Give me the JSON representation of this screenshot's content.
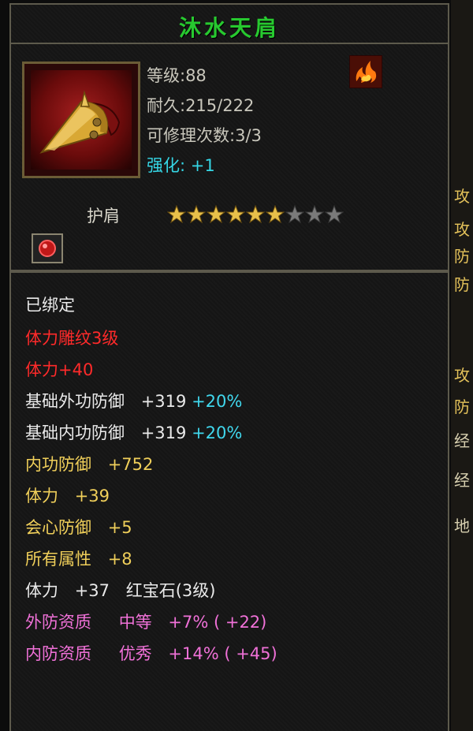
{
  "item": {
    "name": "沐水天肩",
    "type": "护肩",
    "level": "等级:88",
    "durability": "耐久:215/222",
    "repair": "可修理次数:3/3",
    "enhance_label": "强化:",
    "enhance_value": "+1",
    "stars_filled": 6,
    "stars_total": 9
  },
  "stats": {
    "bound": "已绑定",
    "engrave": "体力雕纹3级",
    "engrave_bonus": "体力+40",
    "ext_def_label": "基础外功防御",
    "ext_def_value": "+319",
    "ext_def_pct": "+20%",
    "int_def_label": "基础内功防御",
    "int_def_value": "+319",
    "int_def_pct": "+20%",
    "neigong_label": "内功防御",
    "neigong_value": "+752",
    "tili_label": "体力",
    "tili_value": "+39",
    "crit_def_label": "会心防御",
    "crit_def_value": "+5",
    "all_attr_label": "所有属性",
    "all_attr_value": "+8",
    "gem_label": "体力",
    "gem_value": "+37",
    "gem_name": "红宝石(3级)",
    "ext_quality_label": "外防资质",
    "ext_quality_grade": "中等",
    "ext_quality_pct": "+7%",
    "ext_quality_extra": "( +22)",
    "int_quality_label": "内防资质",
    "int_quality_grade": "优秀",
    "int_quality_pct": "+14%",
    "int_quality_extra": "( +45)"
  },
  "side_panel_chars": [
    "攻",
    "攻",
    "防",
    "防",
    "攻",
    "防",
    "经",
    "经",
    "地"
  ],
  "colors": {
    "title_green": "#27c92f",
    "red": "#ff2a2a",
    "gold": "#f0cf5a",
    "cyan": "#40d8ee",
    "pink": "#f071d8"
  }
}
